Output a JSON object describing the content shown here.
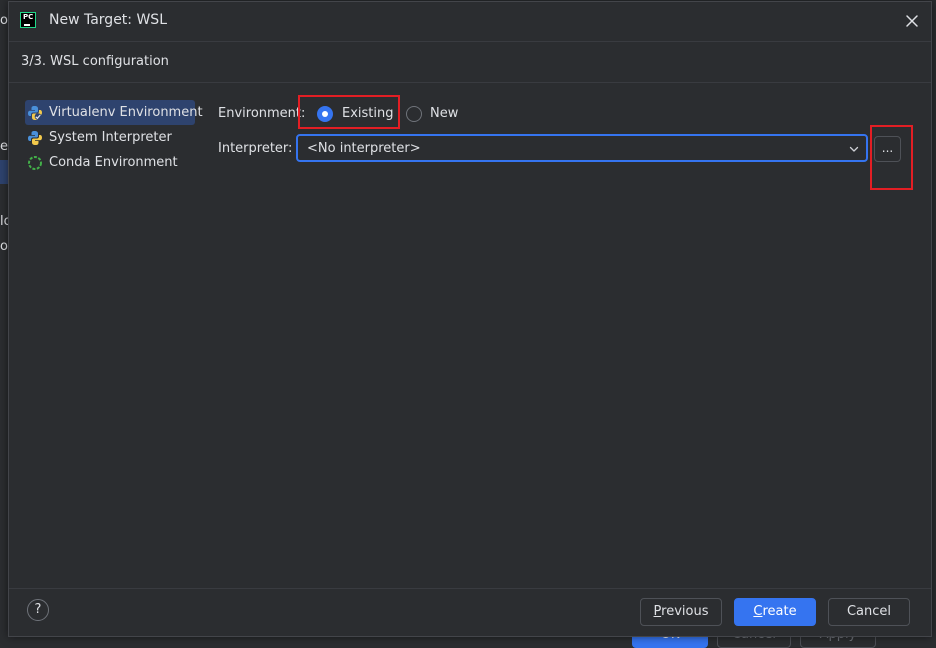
{
  "background": {
    "fragments": [
      "o",
      "er",
      "lo",
      "o"
    ],
    "ok_label": "OK",
    "cancel_label": "Cancel",
    "apply_label": "Apply"
  },
  "window": {
    "title": "New Target: WSL",
    "logo_text": "PC"
  },
  "step": {
    "title": "3/3. WSL configuration"
  },
  "env_list": [
    {
      "label": "Virtualenv Environment",
      "icon": "virtualenv-icon",
      "selected": true
    },
    {
      "label": "System Interpreter",
      "icon": "python-icon",
      "selected": false
    },
    {
      "label": "Conda Environment",
      "icon": "conda-icon",
      "selected": false
    }
  ],
  "form": {
    "environment_label": "Environment:",
    "existing_label": "Existing",
    "new_label": "New",
    "selected_option": "Existing",
    "interpreter_label": "Interpreter:",
    "interpreter_value": "<No interpreter>",
    "browse_label": "..."
  },
  "footer": {
    "help_label": "?",
    "previous_label": "Previous",
    "previous_mnemonic": "P",
    "previous_rest": "revious",
    "create_label": "Create",
    "create_mnemonic": "C",
    "create_rest": "reate",
    "cancel_label": "Cancel"
  },
  "colors": {
    "background": "#2b2d30",
    "accent": "#3574f0",
    "selection": "#2e436e",
    "highlight_annotation": "#e31e24",
    "text": "#dfe1e5"
  }
}
